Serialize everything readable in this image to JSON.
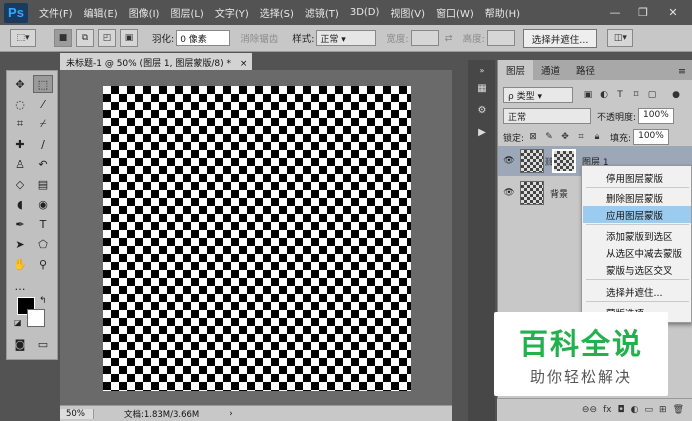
{
  "app": {
    "logo": "Ps"
  },
  "menu": [
    "文件(F)",
    "编辑(E)",
    "图像(I)",
    "图层(L)",
    "文字(Y)",
    "选择(S)",
    "滤镜(T)",
    "3D(D)",
    "视图(V)",
    "窗口(W)",
    "帮助(H)"
  ],
  "window_controls": {
    "minimize": "—",
    "restore": "❐",
    "close": "✕"
  },
  "options": {
    "feather_label": "羽化:",
    "feather_value": "0 像素",
    "antialias_label": "消除锯齿",
    "style_label": "样式:",
    "style_value": "正常",
    "width_label": "宽度:",
    "height_label": "高度:",
    "select_mask_button": "选择并遮住..."
  },
  "document": {
    "tab_title": "未标题-1 @ 50% (图层 1, 图层蒙版/8) *",
    "zoom": "50%",
    "doc_info": "文档:1.83M/3.66M"
  },
  "panel": {
    "tabs": [
      "图层",
      "通道",
      "路径"
    ],
    "filter_kind": "ρ 类型",
    "blend_mode": "正常",
    "opacity_label": "不透明度:",
    "opacity_value": "100%",
    "lock_label": "锁定:",
    "fill_label": "填充:",
    "fill_value": "100%",
    "layers": [
      {
        "name": "图层 1"
      },
      {
        "name": "背景"
      }
    ]
  },
  "context_menu": {
    "items": [
      "停用图层蒙版",
      "删除图层蒙版",
      "应用图层蒙版",
      "添加蒙版到选区",
      "从选区中减去蒙版",
      "蒙版与选区交叉",
      "选择并遮住...",
      "蒙版选项..."
    ],
    "highlighted_index": 2
  },
  "watermark": {
    "title": "百科全说",
    "subtitle": "助你轻松解决"
  },
  "colors": {
    "accent_highlight": "#9ccbf0",
    "watermark_green": "#22b14c",
    "ps_blue": "#31a8ff"
  }
}
